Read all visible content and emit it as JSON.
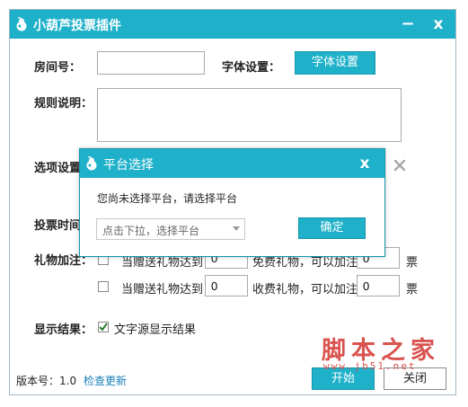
{
  "window": {
    "title": "小葫芦投票插件",
    "minimize": "−",
    "close": "x"
  },
  "form": {
    "room_label": "房间号：",
    "room_value": "",
    "font_label": "字体设置：",
    "font_button": "字体设置",
    "rules_label": "规则说明：",
    "options_label": "选项设置",
    "vote_time_label": "投票时间",
    "gift_label": "礼物加注：",
    "gift_rows": [
      {
        "prefix": "当赠送礼物达到",
        "count": "0",
        "middle": "免费礼物，可以加注",
        "votes": "0",
        "unit": "票"
      },
      {
        "prefix": "当赠送礼物达到",
        "count": "0",
        "middle": "收费礼物，可以加注",
        "votes": "0",
        "unit": "票"
      }
    ],
    "display_label": "显示结果：",
    "display_option": "文字源显示结果",
    "display_checked": true
  },
  "footer": {
    "version_label": "版本号：1.0",
    "check_update": "检查更新",
    "start": "开始",
    "close": "关闭"
  },
  "dialog": {
    "title": "平台选择",
    "close": "x",
    "message": "您尚未选择平台，请选择平台",
    "select_placeholder": "点击下拉，选择平台",
    "confirm": "确定"
  },
  "watermark": {
    "text": "脚本之家",
    "url": "www.jb51.net"
  },
  "colors": {
    "accent": "#1fb1c9",
    "watermark": "#d9534f"
  }
}
